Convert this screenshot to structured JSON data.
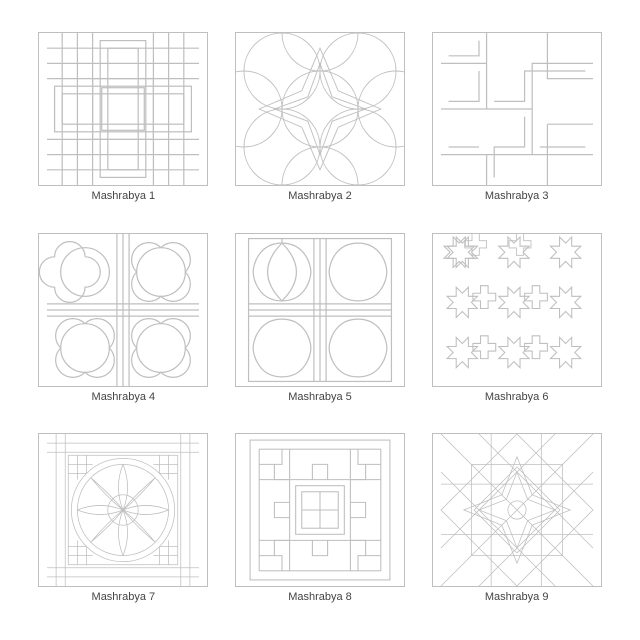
{
  "items": [
    {
      "label": "Mashrabya 1"
    },
    {
      "label": "Mashrabya 2"
    },
    {
      "label": "Mashrabya 3"
    },
    {
      "label": "Mashrabya 4"
    },
    {
      "label": "Mashrabya 5"
    },
    {
      "label": "Mashrabya 6"
    },
    {
      "label": "Mashrabya 7"
    },
    {
      "label": "Mashrabya 8"
    },
    {
      "label": "Mashrabya 9"
    }
  ],
  "stroke": "#bfbfbf"
}
